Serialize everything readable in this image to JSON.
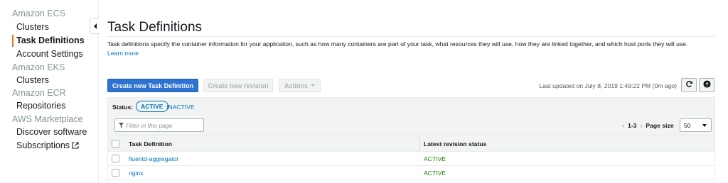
{
  "sidebar": {
    "sections": [
      {
        "title": "Amazon ECS",
        "items": [
          "Clusters",
          "Task Definitions",
          "Account Settings"
        ]
      },
      {
        "title": "Amazon EKS",
        "items": [
          "Clusters"
        ]
      },
      {
        "title": "Amazon ECR",
        "items": [
          "Repositories"
        ]
      },
      {
        "title": "AWS Marketplace",
        "items": [
          "Discover software",
          "Subscriptions"
        ]
      }
    ],
    "active_item": "Task Definitions",
    "accent_color": "#ec7211"
  },
  "page": {
    "title": "Task Definitions",
    "description": "Task definitions specify the container information for your application, such as how many containers are part of your task, what resources they will use, how they are linked together, and which host ports they will use.",
    "learn_more": "Learn more"
  },
  "toolbar": {
    "create_label": "Create new Task Definition",
    "revision_label": "Create new revision",
    "actions_label": "Actions",
    "last_updated": "Last updated on July 8, 2019 1:49:22 PM (0m ago)",
    "refresh_icon": "refresh-icon",
    "help_icon": "help-icon"
  },
  "status_filter": {
    "label": "Status:",
    "active": "ACTIVE",
    "inactive": "INACTIVE"
  },
  "filter": {
    "placeholder": "Filter in this page"
  },
  "pagination": {
    "range": "1-3",
    "page_size_label": "Page size",
    "page_size": "50"
  },
  "table": {
    "columns": [
      "Task Definition",
      "Latest revision status"
    ],
    "rows": [
      {
        "name": "fluentd-aggregator",
        "status": "ACTIVE"
      },
      {
        "name": "nginx",
        "status": "ACTIVE"
      }
    ]
  },
  "colors": {
    "primary": "#2d72d1",
    "link": "#0073bb",
    "status_active": "#1d8102"
  }
}
